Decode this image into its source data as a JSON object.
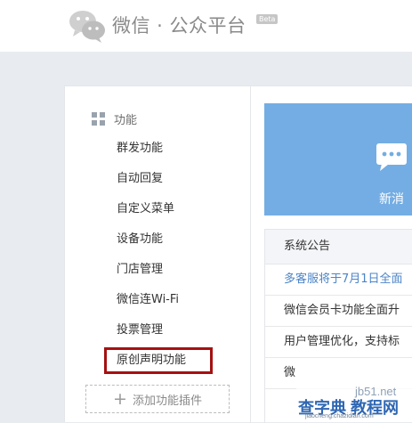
{
  "header": {
    "title": "微信 · 公众平台",
    "badge": "Beta",
    "logo_icon": "wechat-logo-icon"
  },
  "sidebar": {
    "section_icon": "grid-icon",
    "section_label": "功能",
    "items": [
      {
        "label": "群发功能"
      },
      {
        "label": "自动回复"
      },
      {
        "label": "自定义菜单"
      },
      {
        "label": "设备功能"
      },
      {
        "label": "门店管理"
      },
      {
        "label": "微信连Wi-Fi"
      },
      {
        "label": "投票管理"
      },
      {
        "label": "原创声明功能"
      }
    ],
    "highlighted_item": "原创声明功能",
    "add_plugin_label": "添加功能插件"
  },
  "banner": {
    "icon": "chat-bubble-icon",
    "text": "新消"
  },
  "notices": {
    "title": "系统公告",
    "rows": [
      {
        "text": "多客服将于7月1日全面",
        "style": "link"
      },
      {
        "text": "微信会员卡功能全面升",
        "style": "normal"
      },
      {
        "text": "用户管理优化，支持标",
        "style": "normal"
      },
      {
        "text": "微",
        "style": "normal"
      }
    ]
  },
  "watermark": {
    "top": "jb51.net",
    "middle": "查字典 教程网",
    "bottom": "jiaocheng.chazidian.com"
  },
  "colors": {
    "banner": "#74ade3",
    "highlight_border": "#a51111",
    "link": "#4b84c8"
  }
}
